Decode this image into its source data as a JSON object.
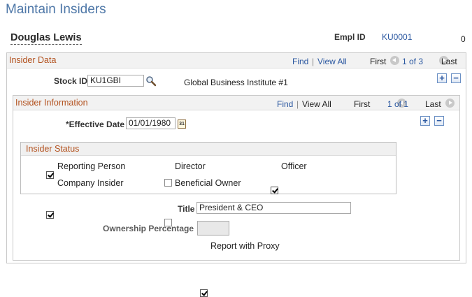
{
  "page": {
    "title": "Maintain Insiders"
  },
  "person": {
    "name": "Douglas Lewis",
    "emplid_label": "Empl ID",
    "emplid": "KU0001",
    "empl_rcd": "0"
  },
  "insider_data": {
    "title": "Insider Data",
    "nav": {
      "find": "Find",
      "separator": "|",
      "view_all": "View All",
      "first": "First",
      "position": "1 of 3",
      "last": "Last"
    },
    "stock_id_label": "Stock ID",
    "stock_id": "KU1GBI",
    "stock_desc": "Global Business Institute #1"
  },
  "insider_information": {
    "title": "Insider Information",
    "nav": {
      "find": "Find",
      "separator": "|",
      "view_all": "View All",
      "first": "First",
      "position": "1 of 1",
      "last": "Last"
    },
    "effective_date_label": "*Effective Date",
    "effective_date": "01/01/1980",
    "calendar_glyph": "31",
    "title_label": "Title",
    "title_value": "President & CEO",
    "ownership_label": "Ownership Percentage",
    "ownership_value": "",
    "report_proxy_label": "Report with Proxy",
    "report_proxy_checked": true
  },
  "insider_status": {
    "title": "Insider Status",
    "items": [
      {
        "label": "Reporting Person",
        "checked": true
      },
      {
        "label": "Director",
        "checked": false
      },
      {
        "label": "Officer",
        "checked": true
      },
      {
        "label": "Company Insider",
        "checked": true
      },
      {
        "label": "Beneficial Owner",
        "checked": false
      }
    ]
  },
  "buttons": {
    "add": "+",
    "delete": "−"
  },
  "icons": {
    "lookup": "magnifier-icon",
    "calendar": "calendar-icon",
    "prev": "prev-arrow-icon",
    "next": "next-arrow-icon"
  },
  "colors": {
    "title_blue": "#4f78a8",
    "section_orange": "#b3521f",
    "link_blue": "#2a57a0"
  }
}
